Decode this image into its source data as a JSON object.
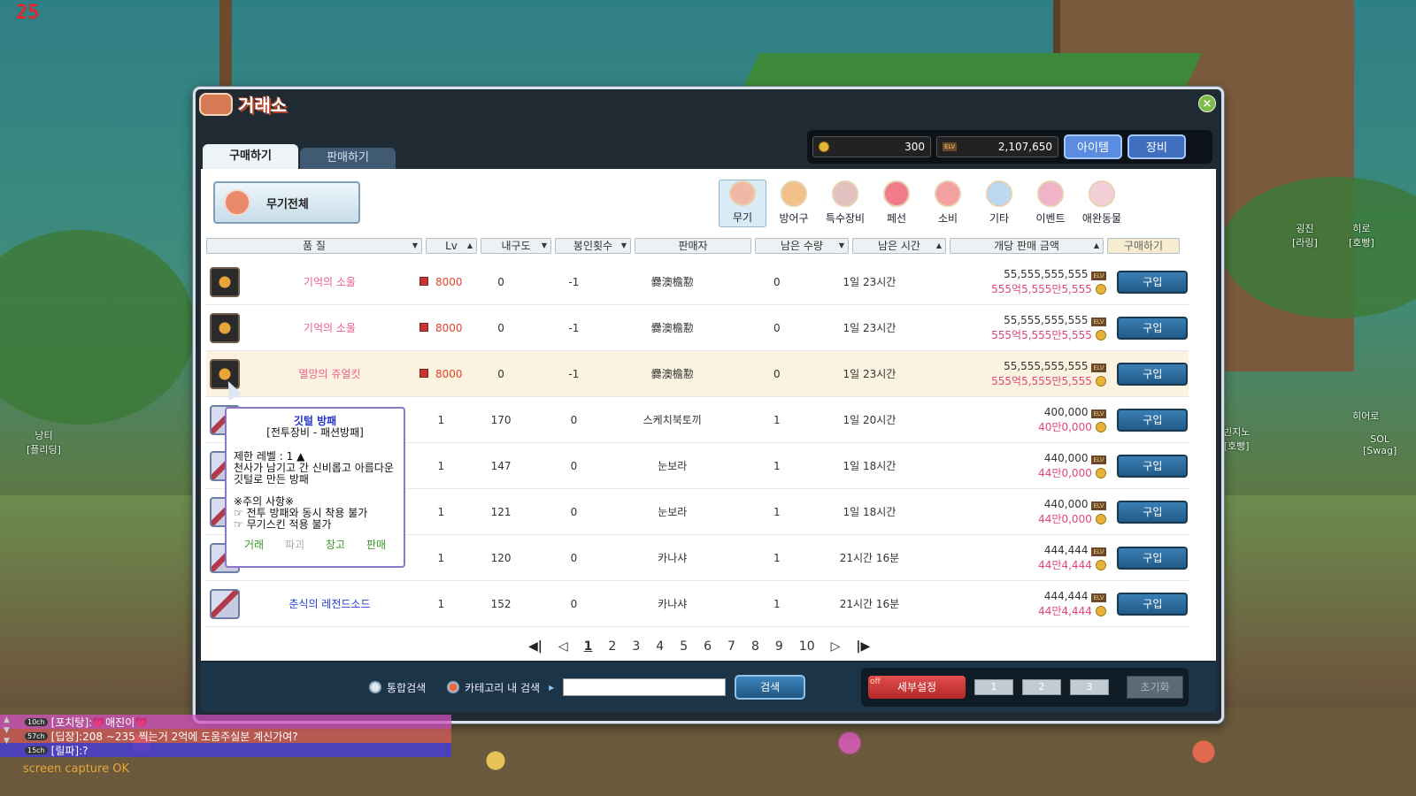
{
  "hud": {
    "channel_counter": "25"
  },
  "npc_tags": [
    {
      "name": "낭티",
      "guild": "[플리딩]"
    },
    {
      "name": "빈지노",
      "guild": "[호빵]"
    },
    {
      "name": "히어로",
      "guild": ""
    },
    {
      "name": "SOL",
      "guild": "[Swag]"
    },
    {
      "name": "굉진",
      "guild": "[라링]"
    },
    {
      "name": "히로",
      "guild": "[호빵]"
    }
  ],
  "window": {
    "title": "거래소",
    "close_label": "×",
    "tabs": [
      {
        "label": "구매하기",
        "active": true
      },
      {
        "label": "판매하기",
        "active": false
      }
    ],
    "currency": {
      "points": "300",
      "mesos": "2,107,650",
      "mesos_tag": "ELV"
    },
    "header_buttons": [
      "아이템",
      "장비"
    ]
  },
  "filter": {
    "weapon_all_label": "무기전체",
    "categories": [
      {
        "label": "무기",
        "active": true,
        "icon": "weapon-icon"
      },
      {
        "label": "방어구",
        "active": false,
        "icon": "armor-icon"
      },
      {
        "label": "특수장비",
        "active": false,
        "icon": "special-gear-icon"
      },
      {
        "label": "페선",
        "active": false,
        "icon": "fashion-icon"
      },
      {
        "label": "소비",
        "active": false,
        "icon": "consumable-icon"
      },
      {
        "label": "기타",
        "active": false,
        "icon": "etc-icon"
      },
      {
        "label": "이벤트",
        "active": false,
        "icon": "event-icon"
      },
      {
        "label": "애완동물",
        "active": false,
        "icon": "pet-icon"
      }
    ]
  },
  "columns": [
    "품 질",
    "Lv",
    "내구도",
    "봉인횟수",
    "판매자",
    "남은 수량",
    "남은 시간",
    "개당 판매 금액",
    "구매하기"
  ],
  "rows": [
    {
      "name": "기억의 소울",
      "name_color": "pink",
      "lv": "8000",
      "dur": "0",
      "seal": "-1",
      "seller": "爨澳檐懃",
      "qty": "0",
      "time": "1일 23시간",
      "price": "55,555,555,555",
      "price_alt": "555억5,555만5,555",
      "icon": "soul",
      "hl": false
    },
    {
      "name": "기억의 소울",
      "name_color": "pink",
      "lv": "8000",
      "dur": "0",
      "seal": "-1",
      "seller": "爨澳檐懃",
      "qty": "0",
      "time": "1일 23시간",
      "price": "55,555,555,555",
      "price_alt": "555억5,555만5,555",
      "icon": "soul",
      "hl": false
    },
    {
      "name": "멸망의 쥬얼킷",
      "name_color": "pink",
      "lv": "8000",
      "dur": "0",
      "seal": "-1",
      "seller": "爨澳檐懃",
      "qty": "0",
      "time": "1일 23시간",
      "price": "55,555,555,555",
      "price_alt": "555억5,555만5,555",
      "icon": "soul",
      "hl": true
    },
    {
      "name": "",
      "name_color": "blue",
      "lv": "1",
      "dur": "170",
      "seal": "0",
      "seller": "스케치북토끼",
      "qty": "1",
      "time": "1일 20시간",
      "price": "400,000",
      "price_alt": "40만0,000",
      "icon": "sword",
      "hl": false
    },
    {
      "name": "",
      "name_color": "blue",
      "lv": "1",
      "dur": "147",
      "seal": "0",
      "seller": "눈보라",
      "qty": "1",
      "time": "1일 18시간",
      "price": "440,000",
      "price_alt": "44만0,000",
      "icon": "sword",
      "hl": false
    },
    {
      "name": "",
      "name_color": "blue",
      "lv": "1",
      "dur": "121",
      "seal": "0",
      "seller": "눈보라",
      "qty": "1",
      "time": "1일 18시간",
      "price": "440,000",
      "price_alt": "44만0,000",
      "icon": "sword",
      "hl": false
    },
    {
      "name": "",
      "name_color": "blue",
      "lv": "1",
      "dur": "120",
      "seal": "0",
      "seller": "카나샤",
      "qty": "1",
      "time": "21시간 16분",
      "price": "444,444",
      "price_alt": "44만4,444",
      "icon": "sword",
      "hl": false
    },
    {
      "name": "춘식의 레전드소드",
      "name_color": "blue",
      "lv": "1",
      "dur": "152",
      "seal": "0",
      "seller": "카나샤",
      "qty": "1",
      "time": "21시간 16분",
      "price": "444,444",
      "price_alt": "44만4,444",
      "icon": "sword",
      "hl": false
    }
  ],
  "buy_label": "구입",
  "pager": {
    "pages": [
      "1",
      "2",
      "3",
      "4",
      "5",
      "6",
      "7",
      "8",
      "9",
      "10"
    ],
    "current": "1"
  },
  "search": {
    "opt_all": "통합검색",
    "opt_category": "카테고리 내 검색",
    "search_btn": "검색",
    "detail_btn": "세부설정",
    "detail_state": "off",
    "slots": [
      "1",
      "2",
      "3"
    ],
    "reset_btn": "초기화"
  },
  "tooltip": {
    "title": "깃털 방패",
    "subtitle": "[전투장비 - 패션방패]",
    "req": "제한 레벨 : 1 ▲",
    "desc": "천사가 남기고 간 신비롭고 아름다운 깃털로 만든 방패",
    "warn_title": "※주의 사항※",
    "warn1": "☞ 전투 방패와 동시 착용 불가",
    "warn2": "☞ 무기스킨 적용 불가",
    "actions": [
      "거래",
      "파괴",
      "창고",
      "판매"
    ]
  },
  "chat": [
    {
      "badge": "10ch",
      "text": "[포치탕]:💗애진이💗"
    },
    {
      "badge": "57ch",
      "text": "[딥장]:208 ~235 찍는거 2억에 도움주실분 계신가여?"
    },
    {
      "badge": "15ch",
      "text": "[릴파]:?"
    }
  ],
  "capture_text": "screen capture OK"
}
